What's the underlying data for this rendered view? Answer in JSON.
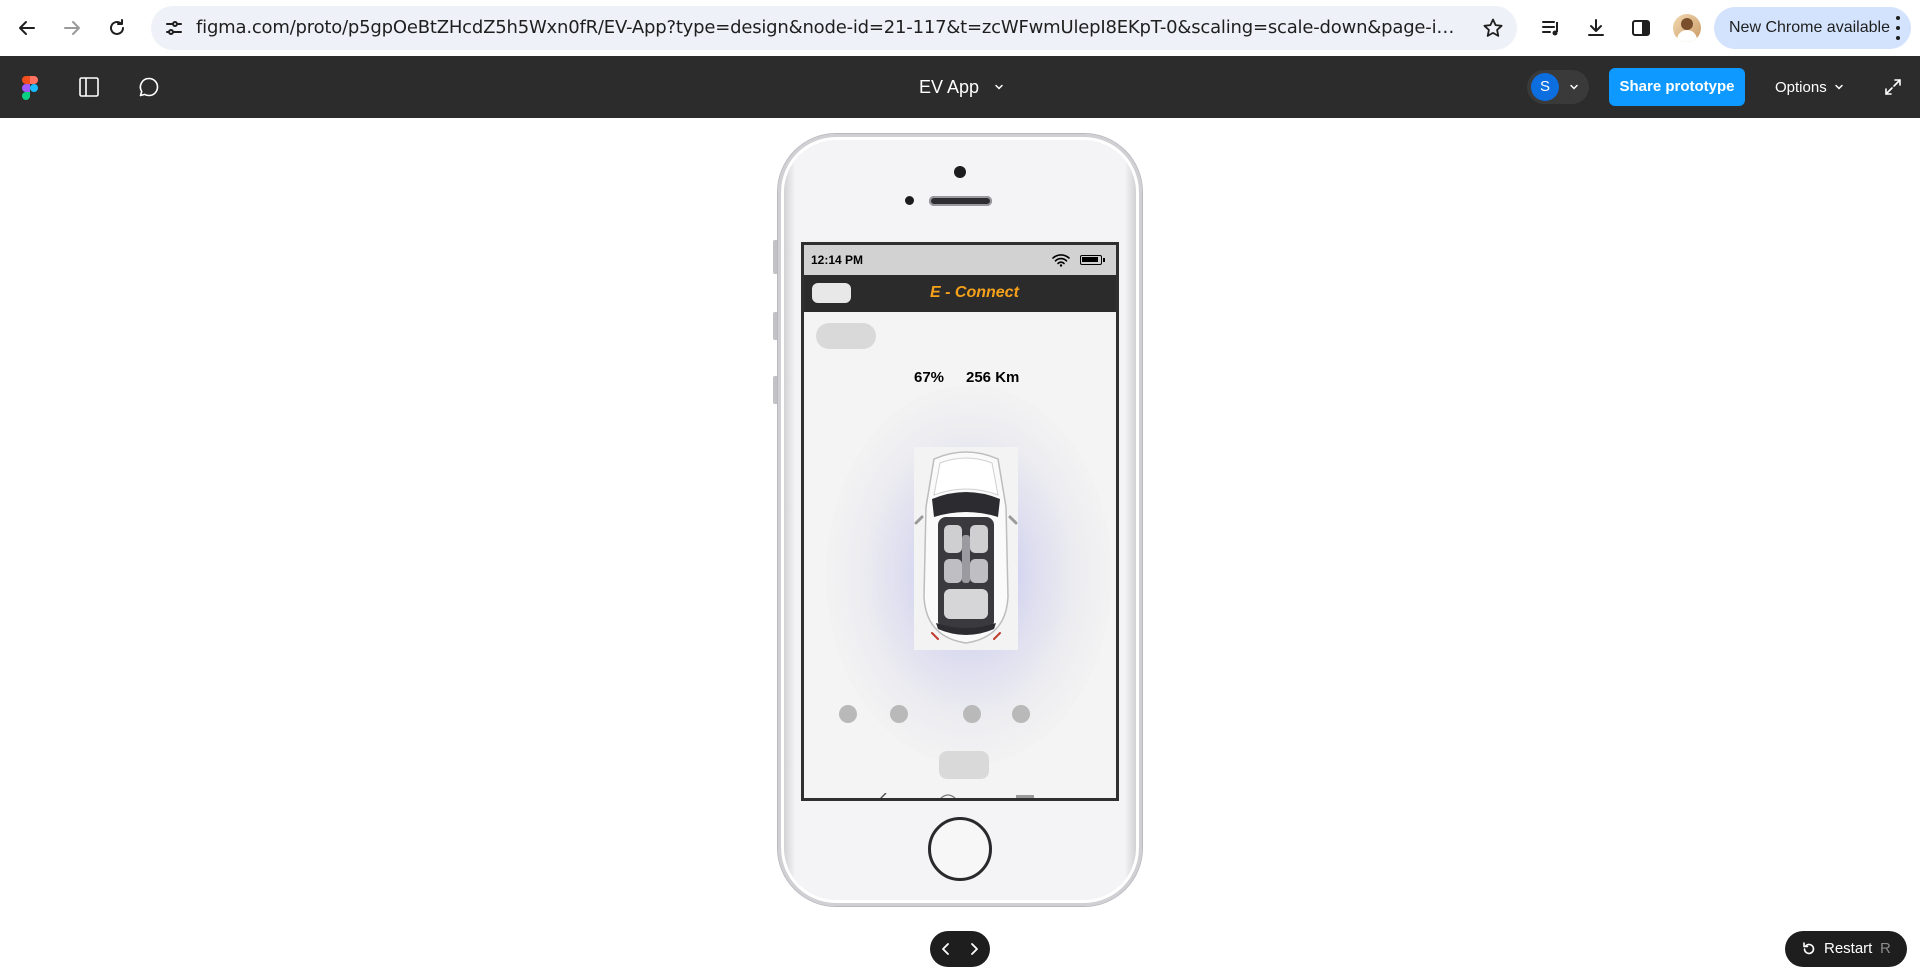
{
  "browser": {
    "url": "figma.com/proto/p5gpOeBtZHcdZ5h5Wxn0fR/EV-App?type=design&node-id=21-117&t=zcWFwmUlepI8EKpT-0&scaling=scale-down&page-id=0%3A1&starting-...",
    "update_label": "New Chrome available",
    "icons": {
      "back": "arrow-left-icon",
      "forward": "arrow-right-icon",
      "reload": "reload-icon",
      "site_info": "tune-icon",
      "bookmark": "star-icon",
      "media": "queue-music-icon",
      "downloads": "download-icon",
      "side_panel": "side-panel-icon",
      "menu": "more-vert-icon"
    }
  },
  "figma": {
    "title": "EV App",
    "avatar_initial": "S",
    "share_label": "Share prototype",
    "options_label": "Options",
    "colors": {
      "share": "#0d99ff",
      "bar": "#2c2c2c",
      "avatar": "#0d6ee0"
    }
  },
  "phone": {
    "status_time": "12:14 PM",
    "app_title": "E - Connect",
    "battery_percent": "67%",
    "range": "256 Km",
    "colors": {
      "brand": "#f5a11a",
      "header": "#2b2b2b"
    }
  },
  "controls": {
    "restart_label": "Restart",
    "restart_shortcut": "R"
  }
}
